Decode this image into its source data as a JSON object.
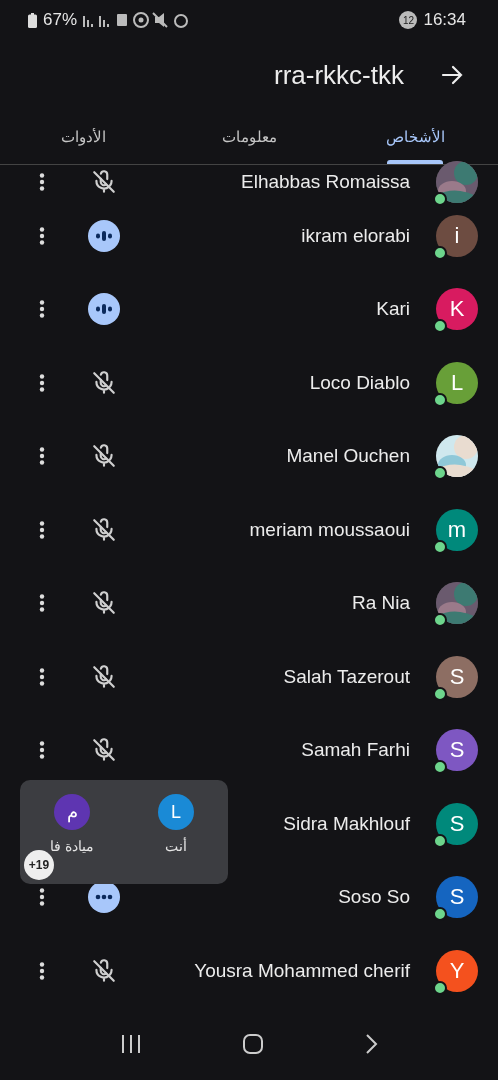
{
  "status_bar": {
    "battery": "67%",
    "notification_count": "12",
    "time": "16:34"
  },
  "header": {
    "title": "rra-rkkc-tkk"
  },
  "tabs": [
    {
      "label": "الأشخاص",
      "selected": true
    },
    {
      "label": "معلومات",
      "selected": false
    },
    {
      "label": "الأدوات",
      "selected": false
    }
  ],
  "participants": [
    {
      "name": "Elhabbas Romaissa",
      "muted": true
    },
    {
      "name": "ikram elorabi",
      "avatar": {
        "kind": "letter",
        "letter": "i",
        "color": "#6d4c41"
      },
      "muted": false,
      "speaking": true
    },
    {
      "name": "Kari",
      "avatar": {
        "kind": "letter",
        "letter": "K",
        "color": "#d81b60"
      },
      "muted": false,
      "speaking": true
    },
    {
      "name": "Loco Diablo",
      "avatar": {
        "kind": "letter",
        "letter": "L",
        "color": "#689f38"
      },
      "muted": true
    },
    {
      "name": "Manel Ouchen",
      "muted": true
    },
    {
      "name": "meriam moussaoui",
      "avatar": {
        "kind": "letter",
        "letter": "m",
        "color": "#00897b"
      },
      "muted": true
    },
    {
      "name": "Ra Nia",
      "muted": true
    },
    {
      "name": "Salah Tazerout",
      "avatar": {
        "kind": "letter",
        "letter": "S",
        "color": "#8d6e63"
      },
      "muted": true
    },
    {
      "name": "Samah Farhi",
      "avatar": {
        "kind": "letter",
        "letter": "S",
        "color": "#7e57c2"
      },
      "muted": true
    },
    {
      "name": "Sidra Makhlouf",
      "avatar": {
        "kind": "letter",
        "letter": "S",
        "color": "#00897b"
      }
    },
    {
      "name": "Soso So",
      "avatar": {
        "kind": "letter",
        "letter": "S",
        "color": "#1565c0"
      },
      "muted": false,
      "speaking": false
    },
    {
      "name": "Yousra Mohammed cherif",
      "avatar": {
        "kind": "letter",
        "letter": "Y",
        "color": "#f4511e"
      },
      "muted": true
    }
  ],
  "popup": {
    "tiles": [
      {
        "label": "أنت",
        "letter": "L",
        "color": "#1a8ad6"
      },
      {
        "label": "ميادة فا",
        "letter": "م",
        "color": "#5e35b1"
      }
    ],
    "more": "+19"
  }
}
